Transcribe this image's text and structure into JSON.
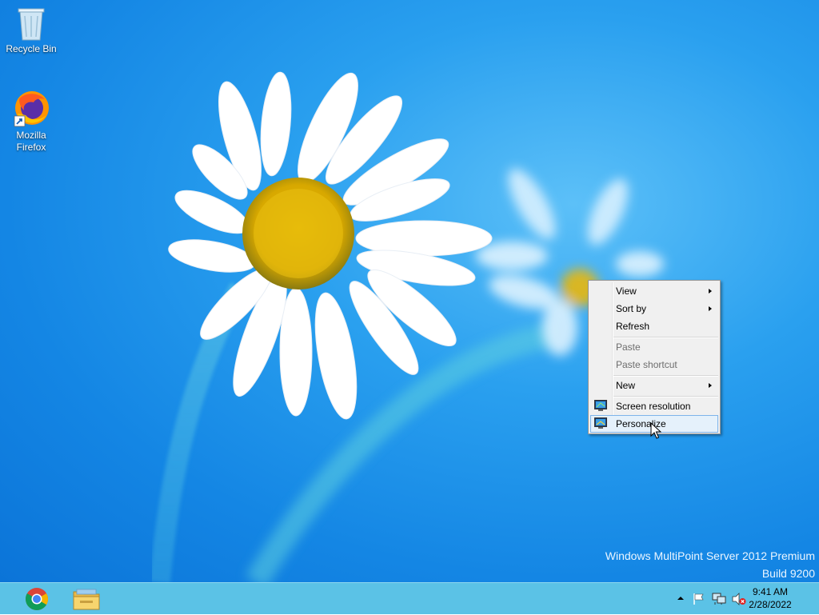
{
  "desktop": {
    "icons": [
      {
        "label": "Recycle Bin",
        "icon": "recycle-bin-icon"
      },
      {
        "label": "Mozilla\nFirefox",
        "icon": "firefox-icon"
      }
    ],
    "watermark": {
      "line1": "Windows MultiPoint Server 2012 Premium",
      "line2": "Build 9200"
    }
  },
  "context_menu": {
    "items": [
      {
        "label": "View",
        "submenu": true
      },
      {
        "label": "Sort by",
        "submenu": true
      },
      {
        "label": "Refresh"
      },
      {
        "label": "Paste",
        "disabled": true
      },
      {
        "label": "Paste shortcut",
        "disabled": true
      },
      {
        "label": "New",
        "submenu": true
      },
      {
        "label": "Screen resolution",
        "icon": "monitor-icon"
      },
      {
        "label": "Personalize",
        "icon": "monitor-icon",
        "highlighted": true
      }
    ]
  },
  "taskbar": {
    "pinned": [
      {
        "icon": "chrome-icon"
      },
      {
        "icon": "file-explorer-icon"
      }
    ],
    "tray": {
      "icons": [
        "show-hidden-icons-icon",
        "action-center-flag-icon",
        "network-icon",
        "volume-muted-icon"
      ],
      "time": "9:41 AM",
      "date": "2/28/2022"
    }
  },
  "colors": {
    "taskbar": "#5bc2e6",
    "menu_background": "#f0f0f0",
    "menu_highlight": "#e5f1fb",
    "menu_highlight_border": "#7eb4ea"
  }
}
